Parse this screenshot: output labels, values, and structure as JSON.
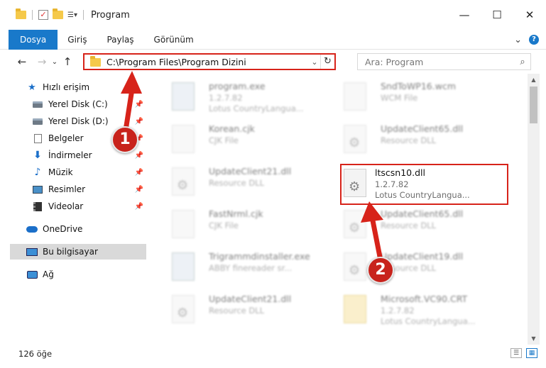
{
  "titlebar": {
    "title": "Program",
    "minimize": "—",
    "maximize": "☐",
    "close": "✕"
  },
  "ribbon": {
    "tabs": [
      "Dosya",
      "Giriş",
      "Paylaş",
      "Görünüm"
    ],
    "active": "Dosya",
    "expand": "⌄",
    "help": "?"
  },
  "address": {
    "path": "C:\\Program Files\\Program Dizini",
    "search_placeholder": "Ara: Program"
  },
  "nav": {
    "items": [
      {
        "label": "Hızlı erişim",
        "icon": "star-icon"
      },
      {
        "label": "Yerel Disk (C:)",
        "icon": "drive-icon",
        "pinned": true
      },
      {
        "label": "Yerel Disk (D:)",
        "icon": "drive-icon",
        "pinned": true
      },
      {
        "label": "Belgeler",
        "icon": "documents-icon",
        "pinned": true
      },
      {
        "label": "İndirmeler",
        "icon": "downloads-icon",
        "pinned": true
      },
      {
        "label": "Müzik",
        "icon": "music-icon",
        "pinned": true
      },
      {
        "label": "Resimler",
        "icon": "pictures-icon",
        "pinned": true
      },
      {
        "label": "Videolar",
        "icon": "videos-icon",
        "pinned": true
      },
      {
        "label": "OneDrive",
        "icon": "onedrive-icon"
      },
      {
        "label": "Bu bilgisayar",
        "icon": "this-pc-icon",
        "selected": true
      },
      {
        "label": "Ağ",
        "icon": "network-icon"
      }
    ]
  },
  "files": {
    "left": [
      {
        "name": "program.exe",
        "line2": "1.2.7.82",
        "line3": "Lotus CountryLangua...",
        "type": "exe"
      },
      {
        "name": "Korean.cjk",
        "line2": "CJK File",
        "line3": "",
        "type": "file"
      },
      {
        "name": "UpdateClient21.dll",
        "line2": "Resource DLL",
        "line3": "",
        "type": "dll"
      },
      {
        "name": "FastNrml.cjk",
        "line2": "CJK File",
        "line3": "",
        "type": "file"
      },
      {
        "name": "Trigrammdinstaller.exe",
        "line2": "ABBY finereader sr...",
        "line3": "",
        "type": "exe"
      },
      {
        "name": "UpdateClient21.dll",
        "line2": "Resource DLL",
        "line3": "",
        "type": "dll"
      }
    ],
    "right": [
      {
        "name": "SndToWP16.wcm",
        "line2": "WCM File",
        "line3": "",
        "type": "file"
      },
      {
        "name": "UpdateClient65.dll",
        "line2": "Resource DLL",
        "line3": "",
        "type": "dll"
      },
      {
        "name": "ltscsn10.dll",
        "line2": "1.2.7.82",
        "line3": "Lotus CountryLangua...",
        "type": "dll",
        "highlighted": true
      },
      {
        "name": "UpdateClient65.dll",
        "line2": "Resource DLL",
        "line3": "",
        "type": "dll"
      },
      {
        "name": "UpdateClient19.dll",
        "line2": "Resource DLL",
        "line3": "",
        "type": "dll"
      },
      {
        "name": "Microsoft.VC90.CRT",
        "line2": "1.2.7.82",
        "line3": "Lotus CountryLangua...",
        "type": "file"
      }
    ]
  },
  "status": {
    "count": "126 öğe"
  },
  "annotations": {
    "badge1": "1",
    "badge2": "2",
    "color": "#d7231a"
  }
}
